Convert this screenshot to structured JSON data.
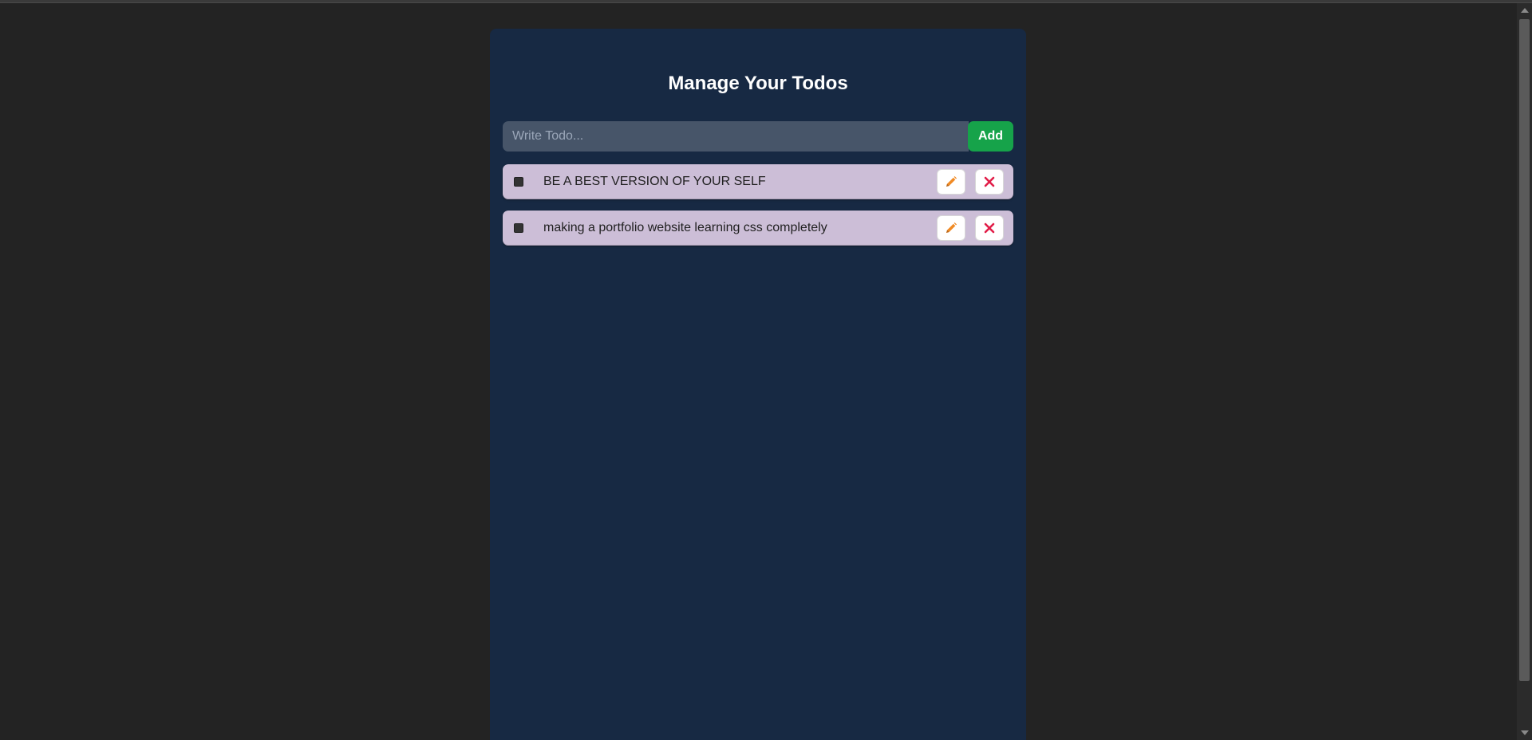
{
  "app": {
    "title": "Manage Your Todos"
  },
  "form": {
    "input_value": "",
    "input_placeholder": "Write Todo...",
    "add_label": "Add"
  },
  "todos": [
    {
      "text": "BE A BEST VERSION OF YOUR SELF",
      "completed": false
    },
    {
      "text": "making a portfolio website learning css completely",
      "completed": false
    }
  ],
  "icons": {
    "edit": "pencil-icon",
    "delete": "close-icon"
  },
  "colors": {
    "page_background": "#232323",
    "panel_background": "#172943",
    "input_background": "#475569",
    "add_button": "#16a34a",
    "todo_item_background": "#ccbed7",
    "edit_icon": "#f08a24",
    "delete_icon": "#e11d48"
  }
}
